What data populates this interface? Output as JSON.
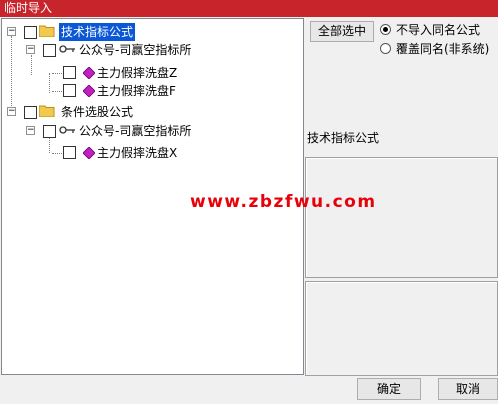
{
  "window": {
    "title": "临时导入"
  },
  "tree": {
    "nodes": [
      {
        "label": "技术指标公式",
        "type": "folder",
        "expanded": true,
        "selected": true
      },
      {
        "label": "公众号-司赢空指标所",
        "type": "author",
        "expanded": true
      },
      {
        "label": "主力假摔洗盘Z",
        "type": "formula"
      },
      {
        "label": "主力假摔洗盘F",
        "type": "formula"
      },
      {
        "label": "条件选股公式",
        "type": "folder",
        "expanded": true
      },
      {
        "label": "公众号-司赢空指标所",
        "type": "author",
        "expanded": true
      },
      {
        "label": "主力假摔洗盘X",
        "type": "formula"
      }
    ]
  },
  "options": {
    "select_all_label": "全部选中",
    "radio_skip_label": "不导入同名公式",
    "radio_overwrite_label": "覆盖同名(非系统)",
    "selected_radio": "skip"
  },
  "info": {
    "label": "技术指标公式"
  },
  "watermark": "www.zbzfwu.com",
  "footer": {
    "ok_label": "确定",
    "cancel_label": "取消"
  },
  "colors": {
    "titlebar": "#c8242c",
    "selection": "#0a58d6",
    "watermark": "#e8000a"
  }
}
